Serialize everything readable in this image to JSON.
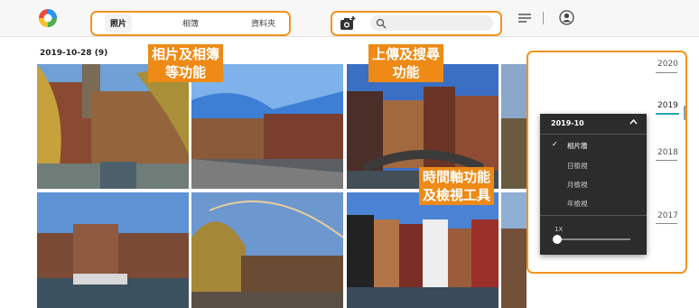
{
  "header": {
    "tabs": [
      {
        "label": "照片",
        "active": true
      },
      {
        "label": "相簿",
        "active": false
      },
      {
        "label": "資料夾",
        "active": false
      }
    ],
    "search": {
      "placeholder": "",
      "value": ""
    },
    "icons": {
      "logo": "app-logo",
      "upload": "camera-upload-icon",
      "search": "search-icon",
      "menu": "menu-icon",
      "account": "account-icon"
    }
  },
  "main": {
    "date_group": "2019-10-28 (9)"
  },
  "annotations": {
    "tabs_note": [
      "相片及相簿",
      "等功能"
    ],
    "upload_note": [
      "上傳及搜尋",
      "功能"
    ],
    "timeline_note": [
      "時間軸功能",
      "及檢視工具"
    ]
  },
  "timeline": {
    "years": [
      "2020",
      "2019",
      "2018",
      "2017"
    ],
    "active_year": "2019"
  },
  "view_panel": {
    "month": "2019-10",
    "options": [
      {
        "label": "相片牆",
        "checked": true
      },
      {
        "label": "日檢視",
        "checked": false
      },
      {
        "label": "月檢視",
        "checked": false
      },
      {
        "label": "年檢視",
        "checked": false
      }
    ],
    "zoom_label": "1X",
    "zoom_level": 0
  },
  "colors": {
    "accent_orange": "#ee8a15",
    "timeline_active": "#2aa6b0",
    "panel_bg": "#2c2c2c"
  }
}
